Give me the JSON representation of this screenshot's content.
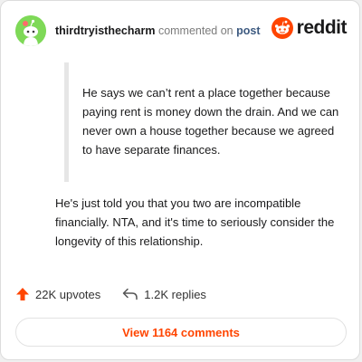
{
  "comment": {
    "username": "thirdtryisthecharm",
    "action_text": "commented on",
    "target_link": "post",
    "quote_text": "He says we can’t rent a place together because paying rent is money down the drain. And we can never own a house together because we agreed to have separate finances.",
    "body_text": "He's just told you that you two are incompatible financially. NTA, and it's time to seriously consider the longevity of this relationship."
  },
  "brand": {
    "wordmark": "reddit",
    "accent_color": "#ff4500"
  },
  "stats": {
    "upvotes": "22K upvotes",
    "replies": "1.2K replies"
  },
  "actions": {
    "view_comments": "View 1164 comments"
  },
  "icons": {
    "avatar": "snoo-avatar-icon",
    "logo": "reddit-alien-icon",
    "upvote": "upvote-arrow-icon",
    "reply": "reply-arrow-icon"
  }
}
